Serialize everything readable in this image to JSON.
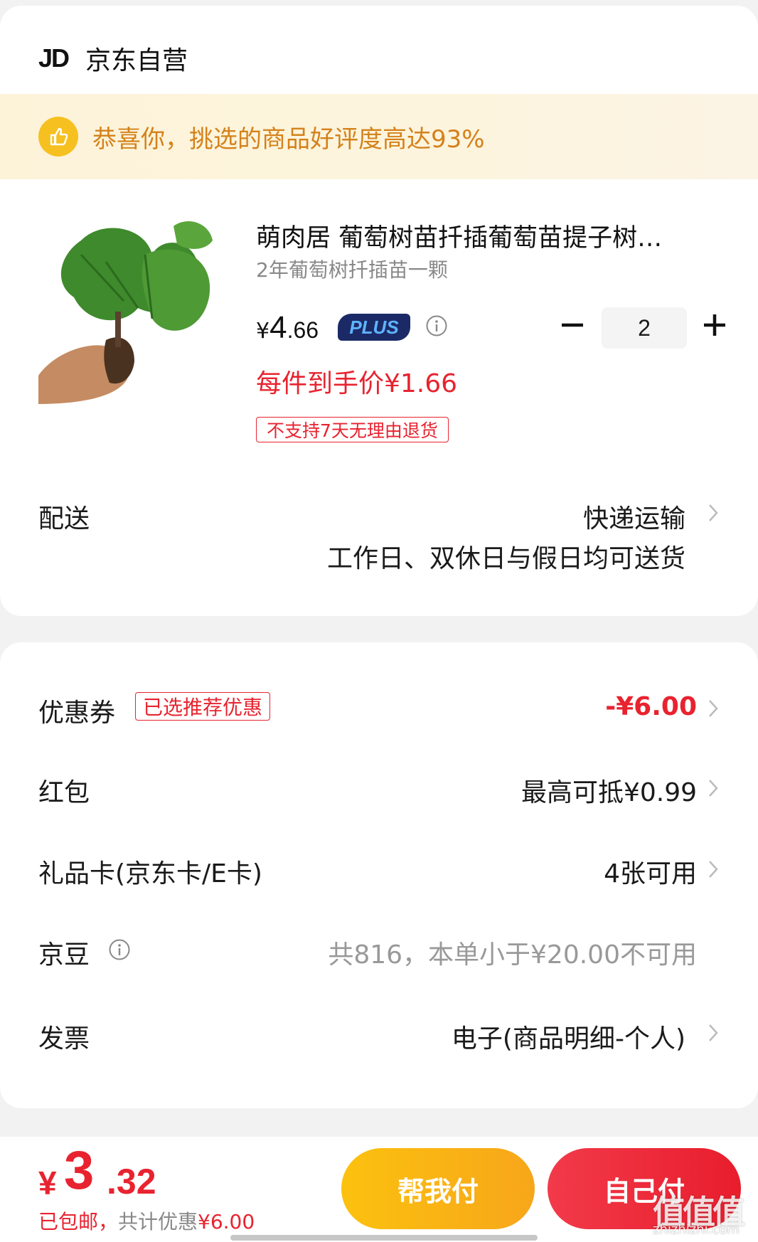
{
  "shop": {
    "logo_text": "JD",
    "name": "京东自营"
  },
  "banner": {
    "icon": "thumbs-up-icon",
    "text": "恭喜你，挑选的商品好评度高达93%"
  },
  "product": {
    "title": "萌肉居 葡萄树苗扦插葡萄苗提子树…",
    "spec": "2年葡萄树扦插苗一颗",
    "price_symbol": "¥",
    "price_int": "4",
    "price_dec": ".66",
    "plus_label": "PLUS",
    "final_price": "每件到手价¥1.66",
    "return_policy": "不支持7天无理由退货",
    "quantity": "2"
  },
  "delivery": {
    "label": "配送",
    "method": "快递运输",
    "note": "工作日、双休日与假日均可送货"
  },
  "benefits": {
    "coupon": {
      "label": "优惠券",
      "tag": "已选推荐优惠",
      "value": "-¥6.00"
    },
    "red_packet": {
      "label": "红包",
      "value": "最高可抵¥0.99"
    },
    "gift_card": {
      "label": "礼品卡(京东卡/E卡)",
      "value": "4张可用"
    },
    "jingdou": {
      "label": "京豆",
      "value": "共816，本单小于¥20.00不可用"
    },
    "invoice": {
      "label": "发票",
      "value": "电子(商品明细-个人)"
    }
  },
  "footer": {
    "total_symbol": "¥",
    "total_int": "3",
    "total_dec": ".32",
    "shipping": "已包邮，",
    "discount_prefix": "共计优惠",
    "discount_value": "¥6.00",
    "help_pay_label": "帮我付",
    "self_pay_label": "自己付"
  },
  "watermark": {
    "text": "值值值",
    "sub": "zhizhizhi.com"
  },
  "colors": {
    "accent_red": "#e8232f",
    "banner_text": "#d4821a",
    "help_button": "#fcc10f",
    "self_button": "#e81d2c"
  }
}
